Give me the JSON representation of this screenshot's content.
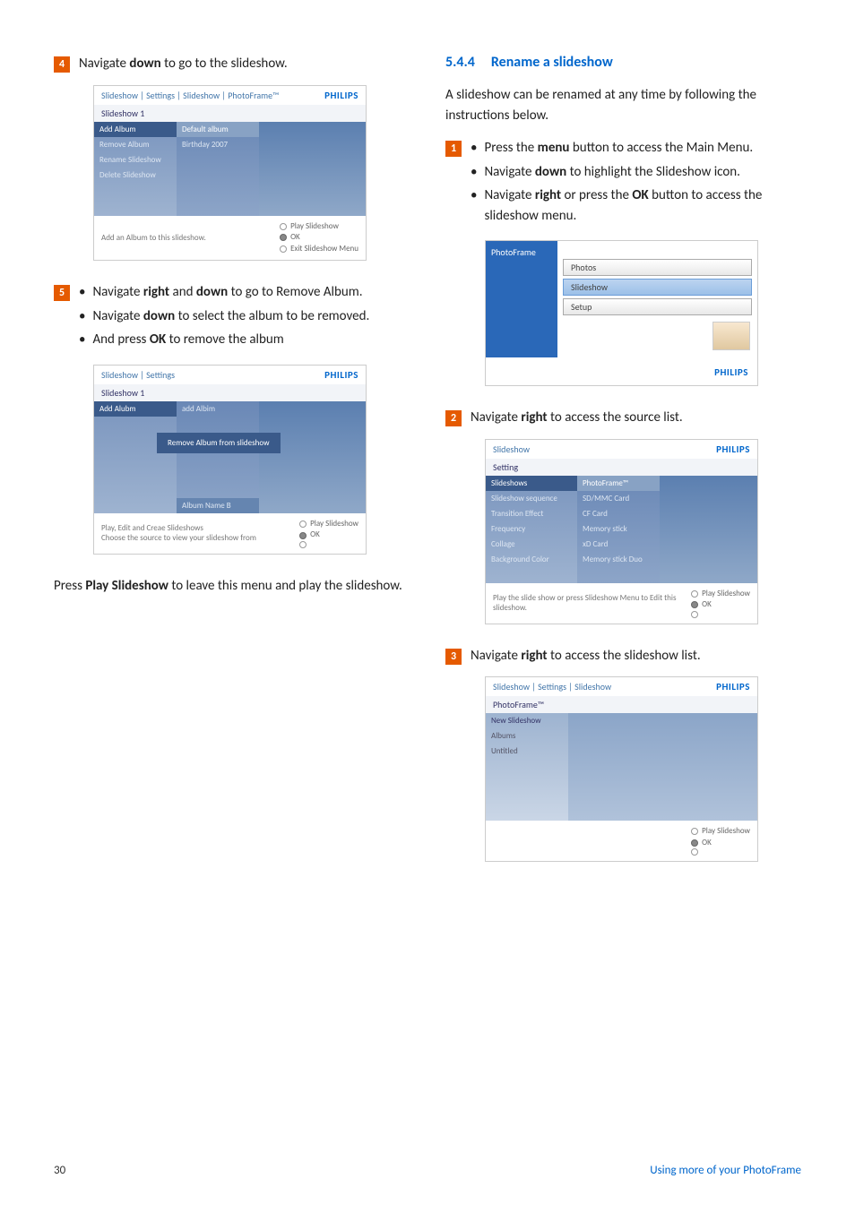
{
  "left": {
    "step4": {
      "num": "4",
      "text_pre": "Navigate ",
      "b1": "down",
      "text_post": " to go to the slideshow."
    },
    "ss1": {
      "breadcrumb": "Slideshow | Settings | Slideshow | PhotoFrame™",
      "brand": "PHILIPS",
      "sub": "Slideshow 1",
      "leftItems": [
        "Add Album",
        "Remove Album",
        "Rename Slideshow",
        "Delete Slideshow"
      ],
      "midItems": [
        "Default album",
        "Birthday 2007"
      ],
      "help": "Add an Album to this slideshow.",
      "controls": [
        "Play Slideshow",
        "OK",
        "Exit Slideshow Menu"
      ]
    },
    "step5": {
      "num": "5",
      "b1": {
        "pre": "Navigate ",
        "b1": "right",
        "mid": " and ",
        "b2": "down",
        "post": " to go to Remove Album."
      },
      "b2": {
        "pre": "Navigate ",
        "b1": "down",
        "post": " to select the album to be removed."
      },
      "b3": {
        "pre": "And press ",
        "b1": "OK",
        "post": " to remove the album"
      }
    },
    "ss2": {
      "breadcrumb": "Slideshow | Settings",
      "brand": "PHILIPS",
      "sub": "Slideshow 1",
      "leftItems": [
        "Add Alubm"
      ],
      "midItems": [
        "add Albim"
      ],
      "popup": "Remove Album from slideshow",
      "albumName": "Album Name B",
      "help": "Play, Edit and Creae Slideshows\nChoose the source to view your slideshow from",
      "controls": [
        "Play Slideshow",
        "OK"
      ]
    },
    "closing": {
      "pre": "Press ",
      "b1": "Play Slideshow",
      "post": " to leave this menu and play the slideshow."
    }
  },
  "right": {
    "heading": {
      "num": "5.4.4",
      "title": "Rename a slideshow"
    },
    "intro": "A slideshow can be renamed at any time by following the instructions below.",
    "step1": {
      "num": "1",
      "b1": {
        "pre": "Press the ",
        "b1": "menu",
        "post": " button to access the Main Menu."
      },
      "b2": {
        "pre": "Navigate ",
        "b1": "down",
        "post": " to highlight the Slideshow icon."
      },
      "b3": {
        "pre": "Navigate ",
        "b1": "right",
        "mid": " or press the ",
        "b2": "OK",
        "post": " button to access the slideshow menu."
      }
    },
    "frame": {
      "title": "PhotoFrame",
      "buttons": [
        "Photos",
        "Slideshow",
        "Setup"
      ],
      "brand": "PHILIPS"
    },
    "step2": {
      "num": "2",
      "pre": "Navigate ",
      "b1": "right",
      "post": " to access the source list."
    },
    "ss3": {
      "breadcrumb": "Slideshow",
      "brand": "PHILIPS",
      "sub": "Setting",
      "leftItems": [
        "Slideshows",
        "Slideshow sequence",
        "Transition Effect",
        "Frequency",
        "Collage",
        "Background Color"
      ],
      "midItems": [
        "PhotoFrame™",
        "SD/MMC Card",
        "CF Card",
        "Memory stick",
        "xD Card",
        "Memory stick Duo"
      ],
      "help": "Play the slide show or press Slideshow Menu to Edit this slideshow.",
      "controls": [
        "Play Slideshow",
        "OK"
      ]
    },
    "step3": {
      "num": "3",
      "pre": "Navigate ",
      "b1": "right",
      "post": " to access the slideshow list."
    },
    "ss4": {
      "breadcrumb": "Slideshow | Settings | Slideshow",
      "brand": "PHILIPS",
      "sub": "PhotoFrame™",
      "leftItems": [
        "New Slideshow",
        "Albums",
        "Untitled"
      ],
      "controls": [
        "Play Slideshow",
        "OK"
      ]
    }
  },
  "footer": {
    "page": "30",
    "section": "Using more of your PhotoFrame"
  }
}
